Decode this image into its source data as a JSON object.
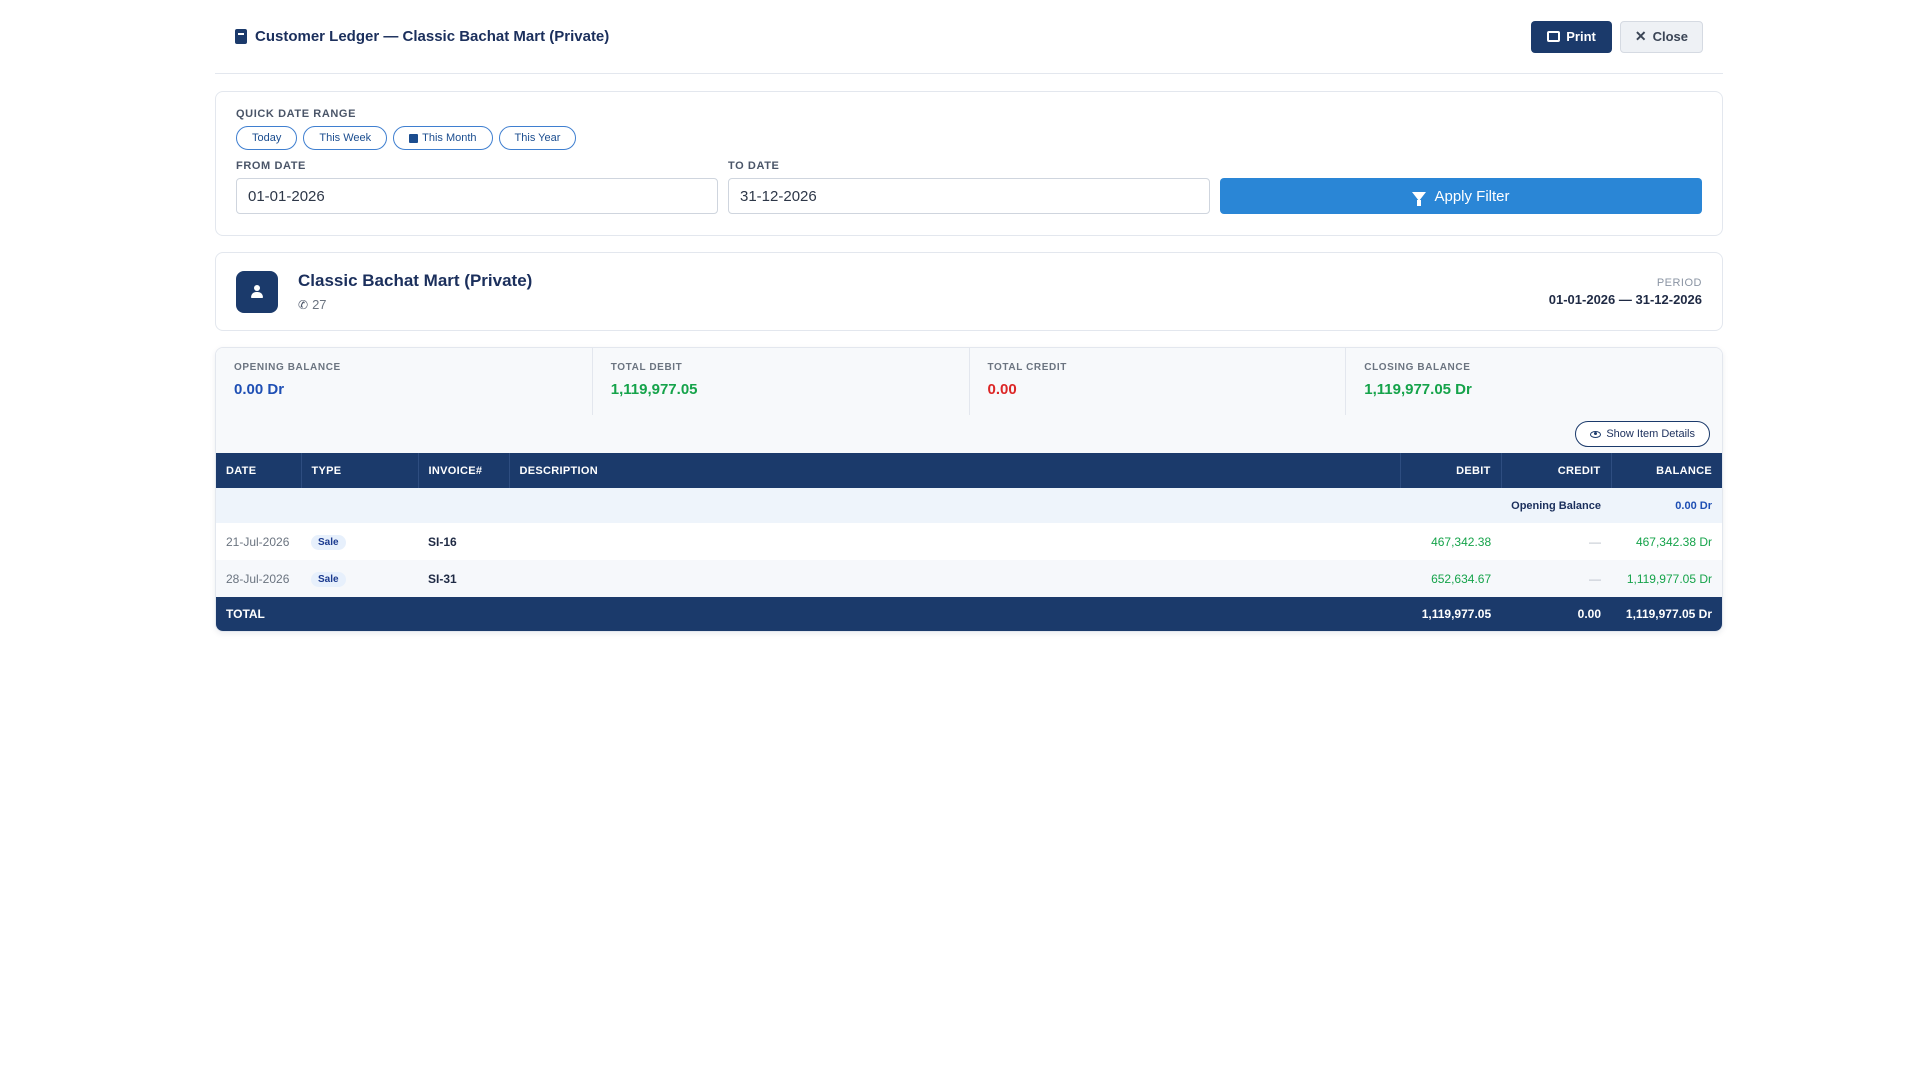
{
  "header": {
    "title": "Customer Ledger — Classic Bachat Mart (Private)",
    "print_label": "Print",
    "close_label": "Close"
  },
  "filter": {
    "quick_label": "QUICK DATE RANGE",
    "chips": [
      "Today",
      "This Week",
      "This Month",
      "This Year"
    ],
    "active_chip": "This Month",
    "from_label": "FROM DATE",
    "from_value": "01-01-2026",
    "to_label": "TO DATE",
    "to_value": "31-12-2026",
    "apply_label": "Apply Filter"
  },
  "customer": {
    "name": "Classic Bachat Mart (Private)",
    "phone": "27",
    "period_label": "PERIOD",
    "period_value": "01-01-2026 — 31-12-2026"
  },
  "summary": {
    "opening_label": "OPENING BALANCE",
    "opening_value": "0.00 Dr",
    "debit_label": "TOTAL DEBIT",
    "debit_value": "1,119,977.05",
    "credit_label": "TOTAL CREDIT",
    "credit_value": "0.00",
    "closing_label": "CLOSING BALANCE",
    "closing_value": "1,119,977.05 Dr"
  },
  "toggle_label": "Show Item Details",
  "table": {
    "headers": {
      "date": "DATE",
      "type": "TYPE",
      "invoice": "INVOICE#",
      "description": "DESCRIPTION",
      "debit": "DEBIT",
      "credit": "CREDIT",
      "balance": "BALANCE"
    },
    "opening": {
      "label": "Opening Balance",
      "balance": "0.00 Dr"
    },
    "rows": [
      {
        "date": "21-Jul-2026",
        "type": "Sale",
        "invoice": "SI-16",
        "description": "",
        "debit": "467,342.38",
        "credit": "—",
        "balance": "467,342.38 Dr"
      },
      {
        "date": "28-Jul-2026",
        "type": "Sale",
        "invoice": "SI-31",
        "description": "",
        "debit": "652,634.67",
        "credit": "—",
        "balance": "1,119,977.05 Dr"
      }
    ],
    "total": {
      "label": "TOTAL",
      "debit": "1,119,977.05",
      "credit": "0.00",
      "balance": "1,119,977.05 Dr"
    }
  },
  "colors": {
    "primary": "#1b3a6b",
    "accent": "#2a86d6",
    "positive": "#15a34a",
    "negative": "#dc2626"
  }
}
